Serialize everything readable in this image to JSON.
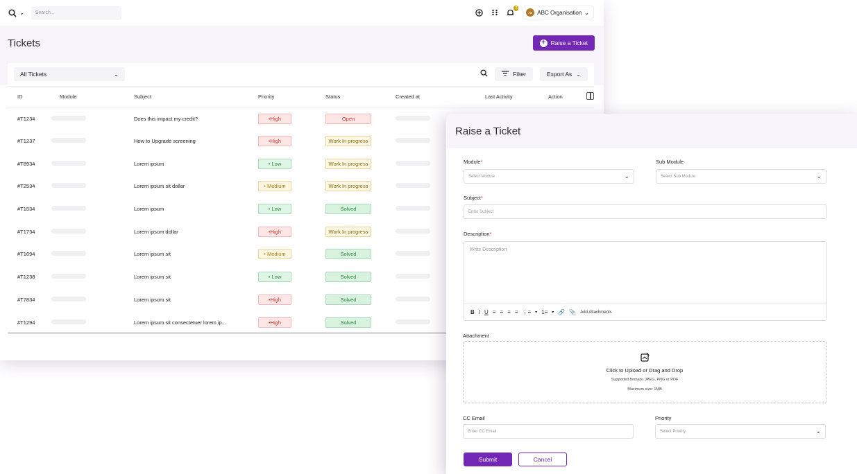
{
  "topbar": {
    "search_placeholder": "Search...",
    "notif_count": "2",
    "org_initials": "AB",
    "org_name": "ABC Organisation"
  },
  "page": {
    "title": "Tickets",
    "raise_button": "Raise a Ticket"
  },
  "filters": {
    "view_select": "All Tickets",
    "filter_label": "Filter",
    "export_label": "Export As"
  },
  "table": {
    "columns": [
      "ID",
      "Module",
      "Subject",
      "Priority",
      "Status",
      "Created at",
      "Last Activity",
      "Action"
    ],
    "rows": [
      {
        "id": "#T1234",
        "subject": "Does this impact my credit?",
        "priority": "•High",
        "priority_level": "high",
        "status": "Open",
        "status_kind": "open"
      },
      {
        "id": "#T1237",
        "subject": "How to Upgrade screening",
        "priority": "•High",
        "priority_level": "high",
        "status": "Work In progress",
        "status_kind": "wip"
      },
      {
        "id": "#T8934",
        "subject": "Lorem ipsum",
        "priority": "• Low",
        "priority_level": "low",
        "status": "Work In progress",
        "status_kind": "wip"
      },
      {
        "id": "#T2534",
        "subject": "Lorem ipsum sit dollar",
        "priority": "• Medium",
        "priority_level": "med",
        "status": "Work In progress",
        "status_kind": "wip"
      },
      {
        "id": "#T1534",
        "subject": "Lorem ipsum",
        "priority": "• Low",
        "priority_level": "low",
        "status": "Solved",
        "status_kind": "solved"
      },
      {
        "id": "#T1734",
        "subject": "Lorem ipsum dollar",
        "priority": "•High",
        "priority_level": "high",
        "status": "Work In progress",
        "status_kind": "wip"
      },
      {
        "id": "#T1694",
        "subject": "Lorem ipsum sit",
        "priority": "• Medium",
        "priority_level": "med",
        "status": "Solved",
        "status_kind": "solved"
      },
      {
        "id": "#T1238",
        "subject": "Lorem ipsum sit",
        "priority": "• Low",
        "priority_level": "low",
        "status": "Solved",
        "status_kind": "solved"
      },
      {
        "id": "#T7834",
        "subject": "Lorem ipsum sit",
        "priority": "•High",
        "priority_level": "high",
        "status": "Solved",
        "status_kind": "solved"
      },
      {
        "id": "#T1294",
        "subject": "Lorem ipsum sit consectetuer lorem ip...",
        "priority": "•High",
        "priority_level": "high",
        "status": "Solved",
        "status_kind": "solved"
      }
    ]
  },
  "dialog": {
    "title": "Raise a Ticket",
    "module_label": "Module",
    "module_placeholder": "Select Module",
    "submodule_label": "Sub Module",
    "submodule_placeholder": "Select Sub Module",
    "subject_label": "Subject",
    "subject_placeholder": "Enter Subject",
    "description_label": "Description",
    "description_placeholder": "Write Description",
    "add_attachments": "Add Attachments",
    "attachment_label": "Attachment",
    "upload_title": "Click to Upload or Drag and Drop",
    "upload_formats": "Supported formats: JPEG, PNG or PDF",
    "upload_max": "Maximum size: 1MB",
    "cc_label": "CC Email",
    "cc_placeholder": "Enter CC Email",
    "priority_label": "Priority",
    "priority_placeholder": "Select Priority",
    "required_mark": "*",
    "submit": "Submit",
    "cancel": "Cancel"
  },
  "colors": {
    "accent": "#7228b5",
    "header_bg": "#f7f4fc"
  }
}
